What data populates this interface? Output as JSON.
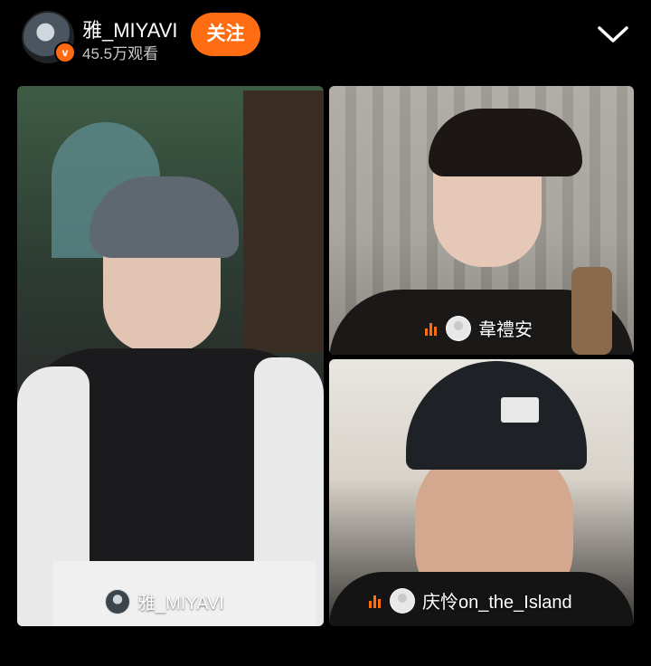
{
  "header": {
    "username": "雅_MIYAVI",
    "viewers": "45.5万观看",
    "follow_label": "关注",
    "verified_badge": "v",
    "accent_color": "#ff6d12"
  },
  "tiles": [
    {
      "name": "雅_MIYAVI",
      "indicator": "avatar"
    },
    {
      "name": "韋禮安",
      "indicator": "mic+avatar"
    },
    {
      "name": "庆怜on_the_Island",
      "indicator": "mic+avatar"
    }
  ],
  "icons": {
    "collapse": "chevron-down-icon",
    "speaking": "audio-level-icon",
    "verified": "verified-badge-icon"
  }
}
